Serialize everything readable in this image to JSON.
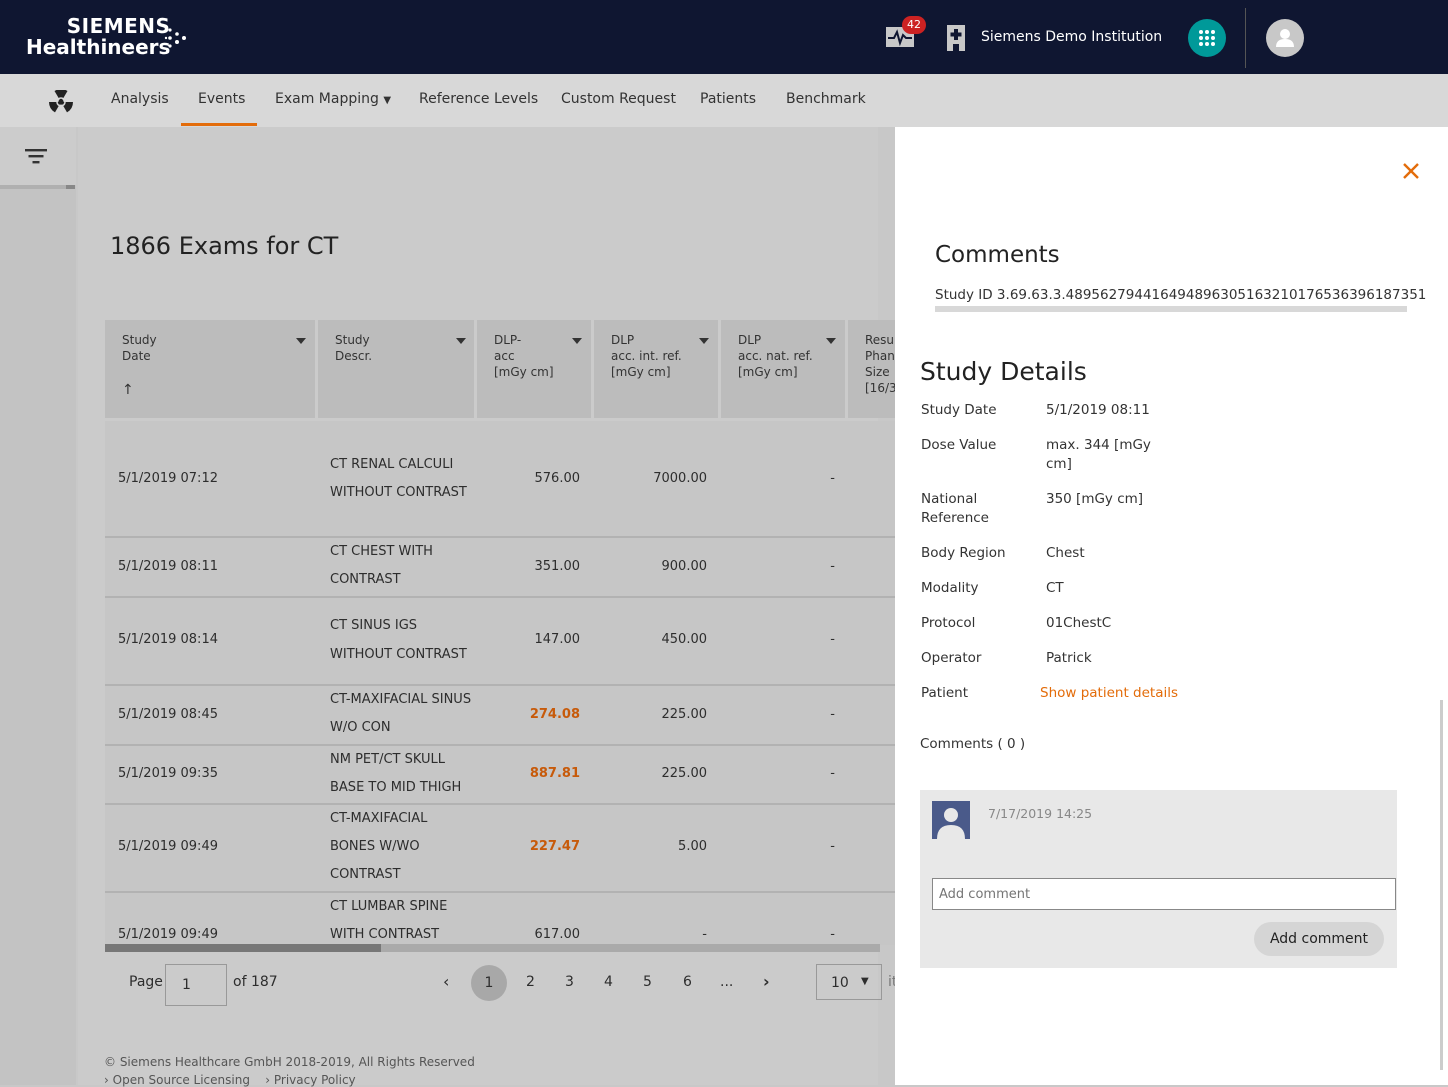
{
  "header": {
    "brand_line1": "SIEMENS",
    "brand_line2": "Healthineers",
    "notification_count": "42",
    "institution": "Siemens Demo Institution",
    "icons": [
      "activity-monitor-icon",
      "hospital-icon",
      "apps-grid-icon",
      "user-icon"
    ],
    "accent_color": "#009999"
  },
  "nav": {
    "items": [
      {
        "label": "Analysis"
      },
      {
        "label": "Events"
      },
      {
        "label": "Exam Mapping"
      },
      {
        "label": "Reference Levels"
      },
      {
        "label": "Custom Request"
      },
      {
        "label": "Patients"
      },
      {
        "label": "Benchmark"
      }
    ],
    "active": "Events",
    "active_color": "#e36c0a"
  },
  "main": {
    "title": "1866 Exams for CT",
    "columns": [
      {
        "l1": "Study",
        "l2": "Date",
        "l3": ""
      },
      {
        "l1": "Study",
        "l2": "Descr.",
        "l3": ""
      },
      {
        "l1": "DLP-",
        "l2": "acc",
        "l3": "[mGy cm]"
      },
      {
        "l1": "DLP",
        "l2": "acc. int. ref.",
        "l3": "[mGy cm]"
      },
      {
        "l1": "DLP",
        "l2": "acc. nat. ref.",
        "l3": "[mGy cm]"
      },
      {
        "l1": "Resu",
        "l2": "Phan",
        "l3": "Size",
        "l4": "[16/3"
      }
    ],
    "sort_indicator": "↑",
    "rows": [
      {
        "date": "5/1/2019 07:12",
        "descr": [
          "CT RENAL CALCULI",
          "WITHOUT CONTRAST"
        ],
        "dlp": "576.00",
        "int_ref": "7000.00",
        "nat_ref": "-",
        "over": false
      },
      {
        "date": "5/1/2019 08:11",
        "descr": [
          "CT CHEST WITH",
          "CONTRAST"
        ],
        "dlp": "351.00",
        "int_ref": "900.00",
        "nat_ref": "-",
        "over": false
      },
      {
        "date": "5/1/2019 08:14",
        "descr": [
          "CT SINUS IGS",
          "WITHOUT CONTRAST"
        ],
        "dlp": "147.00",
        "int_ref": "450.00",
        "nat_ref": "-",
        "over": false
      },
      {
        "date": "5/1/2019 08:45",
        "descr": [
          "CT-MAXIFACIAL SINUS",
          "W/O CON"
        ],
        "dlp": "274.08",
        "int_ref": "225.00",
        "nat_ref": "-",
        "over": true
      },
      {
        "date": "5/1/2019 09:35",
        "descr": [
          "NM PET/CT SKULL",
          "BASE TO MID THIGH"
        ],
        "dlp": "887.81",
        "int_ref": "225.00",
        "nat_ref": "-",
        "over": true
      },
      {
        "date": "5/1/2019 09:49",
        "descr": [
          "CT-MAXIFACIAL",
          "BONES W/WO",
          "CONTRAST"
        ],
        "dlp": "227.47",
        "int_ref": "5.00",
        "nat_ref": "-",
        "over": true
      },
      {
        "date": "5/1/2019 09:49",
        "descr": [
          "CT LUMBAR SPINE",
          "WITH CONTRAST"
        ],
        "dlp": "617.00",
        "int_ref": "-",
        "nat_ref": "-",
        "over": false
      }
    ],
    "highlight_color": "#c75a0a"
  },
  "pager": {
    "page_label": "Page",
    "page_value": "1",
    "of_label": "of 187",
    "pages": [
      "1",
      "2",
      "3",
      "4",
      "5",
      "6",
      "..."
    ],
    "current": "1",
    "page_size": "10",
    "trailing": "it"
  },
  "footer": {
    "copyright": "© Siemens Healthcare GmbH 2018-2019, All Rights Reserved",
    "links": [
      "Open Source Licensing",
      "Privacy Policy"
    ]
  },
  "panel": {
    "comments_title": "Comments",
    "study_id": "Study ID 3.69.63.3.4895627944164948963051632101765363961873​51",
    "details_title": "Study Details",
    "details": [
      {
        "label": "Study Date",
        "value": "5/1/2019 08:11"
      },
      {
        "label": "Dose Value",
        "value": "max. 344 [mGy cm]"
      },
      {
        "label": "National Reference",
        "value": "350 [mGy cm]"
      },
      {
        "label": "Body Region",
        "value": "Chest"
      },
      {
        "label": "Modality",
        "value": "CT"
      },
      {
        "label": "Protocol",
        "value": "01ChestC"
      },
      {
        "label": "Operator",
        "value": "Patrick"
      },
      {
        "label": "Patient",
        "value": "Show patient details"
      }
    ],
    "comments_count": "Comments ( 0 )",
    "comment_time": "7/17/2019 14:25",
    "comment_placeholder": "Add comment",
    "add_button": "Add comment"
  }
}
